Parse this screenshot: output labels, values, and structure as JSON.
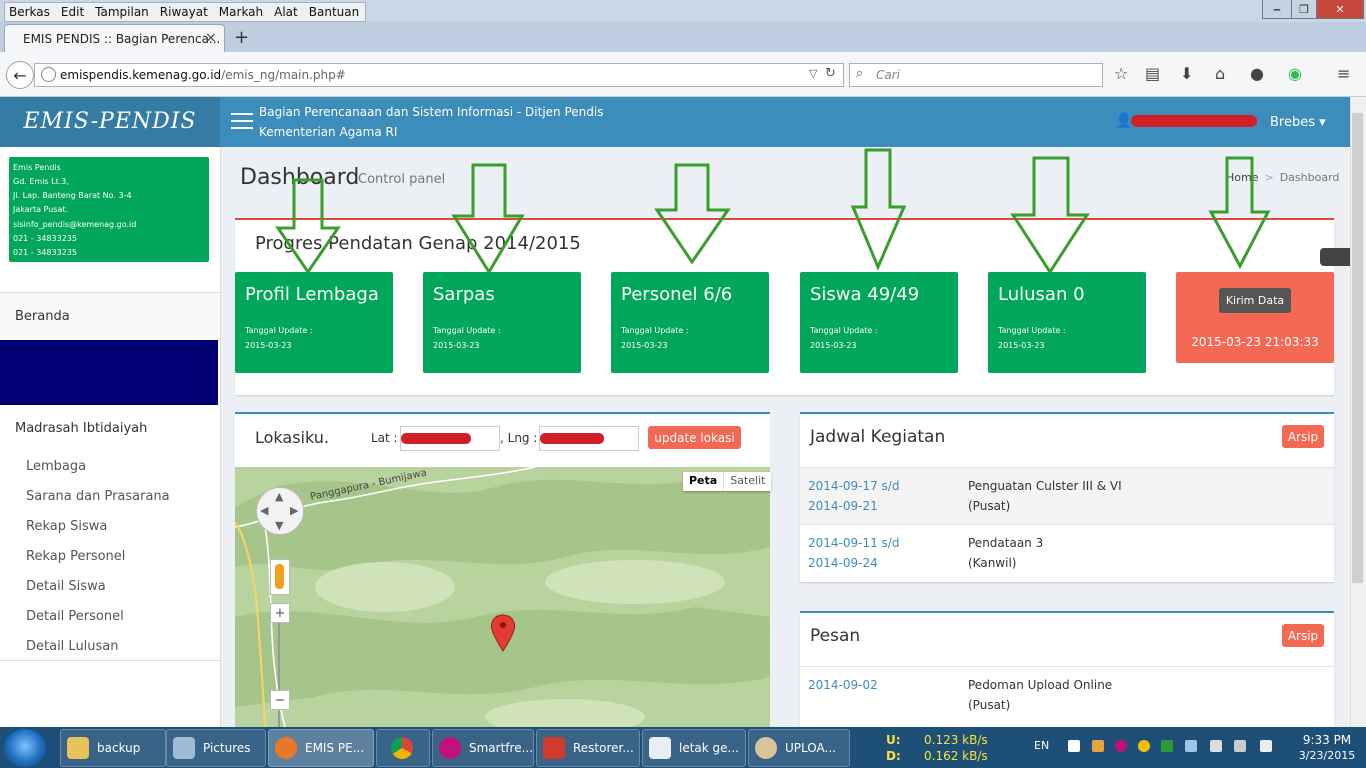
{
  "menubar": {
    "items": [
      "Berkas",
      "Edit",
      "Tampilan",
      "Riwayat",
      "Markah",
      "Alat",
      "Bantuan"
    ]
  },
  "browser": {
    "tab_title": "EMIS PENDIS :: Bagian Perenca...",
    "url_host": "emispendis.kemenag.go.id",
    "url_path": "/emis_ng/main.php#",
    "search_placeholder": "Cari"
  },
  "header": {
    "logo": "EMIS-PENDIS",
    "line1": "Bagian Perencanaan dan Sistem Informasi - Ditjen Pendis",
    "line2": "Kementerian Agama RI",
    "user_location": "Brebes"
  },
  "sidebar": {
    "address_lines": [
      "Emis Pendis",
      "Gd. Emis Lt.3,",
      "Jl. Lap. Banteng Barat No. 3-4",
      "Jakarta Pusat.",
      "sisinfo_pendis@kemenag.go.id",
      "021 - 34833235",
      "021 - 34833235"
    ],
    "beranda": "Beranda",
    "section": "Madrasah Ibtidaiyah",
    "items": [
      "Lembaga",
      "Sarana dan Prasarana",
      "Rekap Siswa",
      "Rekap Personel",
      "Detail Siswa",
      "Detail Personel",
      "Detail Lulusan"
    ]
  },
  "content": {
    "title": "Dashboard",
    "subtitle": "Control panel",
    "breadcrumb_home": "Home",
    "breadcrumb_current": "Dashboard",
    "progress_title": "Progres Pendatan Genap 2014/2015",
    "cards": [
      {
        "title": "Profil Lembaga",
        "label": "Tanggal Update :",
        "date": "2015-03-23"
      },
      {
        "title": "Sarpas",
        "label": "Tanggal Update :",
        "date": "2015-03-23"
      },
      {
        "title": "Personel 6/6",
        "label": "Tanggal Update :",
        "date": "2015-03-23"
      },
      {
        "title": "Siswa 49/49",
        "label": "Tanggal Update :",
        "date": "2015-03-23"
      },
      {
        "title": "Lulusan 0",
        "label": "Tanggal Update :",
        "date": "2015-03-23"
      }
    ],
    "send_button": "Kirim Data",
    "send_timestamp": "2015-03-23 21:03:33",
    "location": {
      "title": "Lokasiku.",
      "lat_label": "Lat :",
      "lng_label": ", Lng :",
      "update_button": "update lokasi",
      "map_type_map": "Peta",
      "map_type_sat": "Satelit",
      "road_label": "Panggapura - Bumijawa"
    },
    "schedule": {
      "title": "Jadwal Kegiatan",
      "archive_button": "Arsip",
      "rows": [
        {
          "date1": "2014-09-17 s/d",
          "date2": "2014-09-21",
          "event": "Penguatan Culster III & VI",
          "level": "(Pusat)"
        },
        {
          "date1": "2014-09-11 s/d",
          "date2": "2014-09-24",
          "event": "Pendataan 3",
          "level": "(Kanwil)"
        }
      ]
    },
    "messages": {
      "title": "Pesan",
      "archive_button": "Arsip",
      "rows": [
        {
          "date": "2014-09-02",
          "subject": "Pedoman Upload Online",
          "level": "(Pusat)"
        }
      ]
    }
  },
  "taskbar": {
    "items": [
      "backup",
      "Pictures",
      "EMIS PE...",
      "",
      "Smartfre...",
      "Restorer...",
      "letak ge...",
      "UPLOA..."
    ],
    "net_u_label": "U:",
    "net_u": "0.123 kB/s",
    "net_d_label": "D:",
    "net_d": "0.162 kB/s",
    "lang": "EN",
    "time": "9:33 PM",
    "date": "3/23/2015"
  },
  "colors": {
    "green": "#00a65a",
    "blue": "#3c8dbc",
    "red": "#f56954",
    "navy": "#000073",
    "arrow": "#3a9e2e"
  }
}
